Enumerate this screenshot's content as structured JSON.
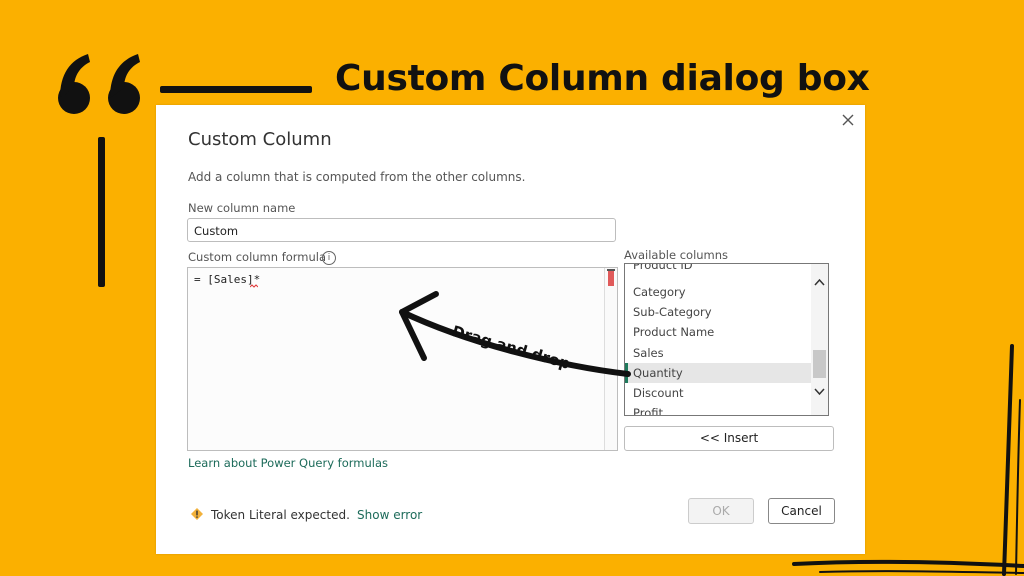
{
  "slide": {
    "heading": "Custom Column dialog box",
    "annotation": "Drag and drop",
    "background_color": "#fbb000"
  },
  "dialog": {
    "title": "Custom Column",
    "subtitle": "Add a column that is computed from the other columns.",
    "new_column_label": "New column name",
    "new_column_value": "Custom",
    "formula_label": "Custom column formula",
    "info_icon": "i",
    "formula_value": "= [Sales]*",
    "learn_link": "Learn about Power Query formulas",
    "available_label": "Available columns",
    "available_columns": [
      "Product ID",
      "Category",
      "Sub-Category",
      "Product Name",
      "Sales",
      "Quantity",
      "Discount",
      "Profit"
    ],
    "selected_column": "Quantity",
    "insert_label": "<< Insert",
    "warning_text": "Token Literal expected.",
    "show_error_label": "Show error",
    "ok_label": "OK",
    "cancel_label": "Cancel",
    "link_color": "#1d6b5a",
    "selection_accent": "#1f7a5c"
  }
}
